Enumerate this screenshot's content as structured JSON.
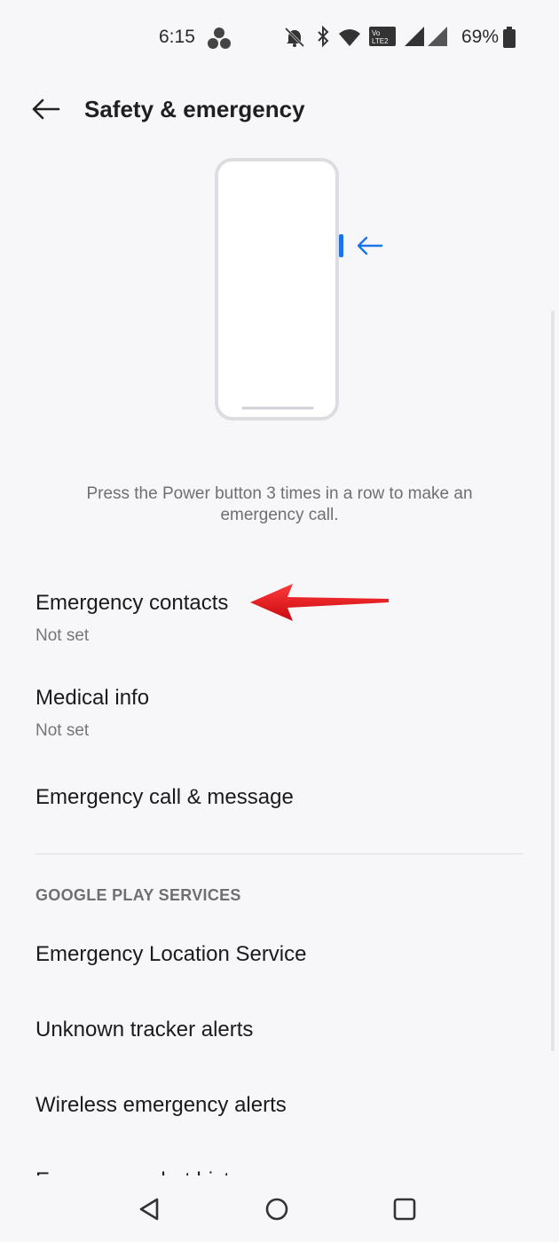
{
  "status_bar": {
    "time": "6:15",
    "battery": "69%"
  },
  "header": {
    "title": "Safety & emergency"
  },
  "illustration": {
    "description": "Press the Power button 3 times in a row to make an emergency call."
  },
  "items": [
    {
      "title": "Emergency contacts",
      "subtitle": "Not set"
    },
    {
      "title": "Medical info",
      "subtitle": "Not set"
    },
    {
      "title": "Emergency call & message"
    }
  ],
  "google_section": {
    "header": "GOOGLE PLAY SERVICES",
    "items": [
      {
        "title": "Emergency Location Service"
      },
      {
        "title": "Unknown tracker alerts"
      },
      {
        "title": "Wireless emergency alerts"
      },
      {
        "title": "Emergency alert history"
      }
    ]
  },
  "colors": {
    "accent_blue": "#1a73e8",
    "annotation_red": "#e8131a"
  },
  "icons": [
    "back-arrow-icon",
    "phone-illustration",
    "nav-back-icon",
    "nav-home-icon",
    "nav-recents-icon"
  ]
}
